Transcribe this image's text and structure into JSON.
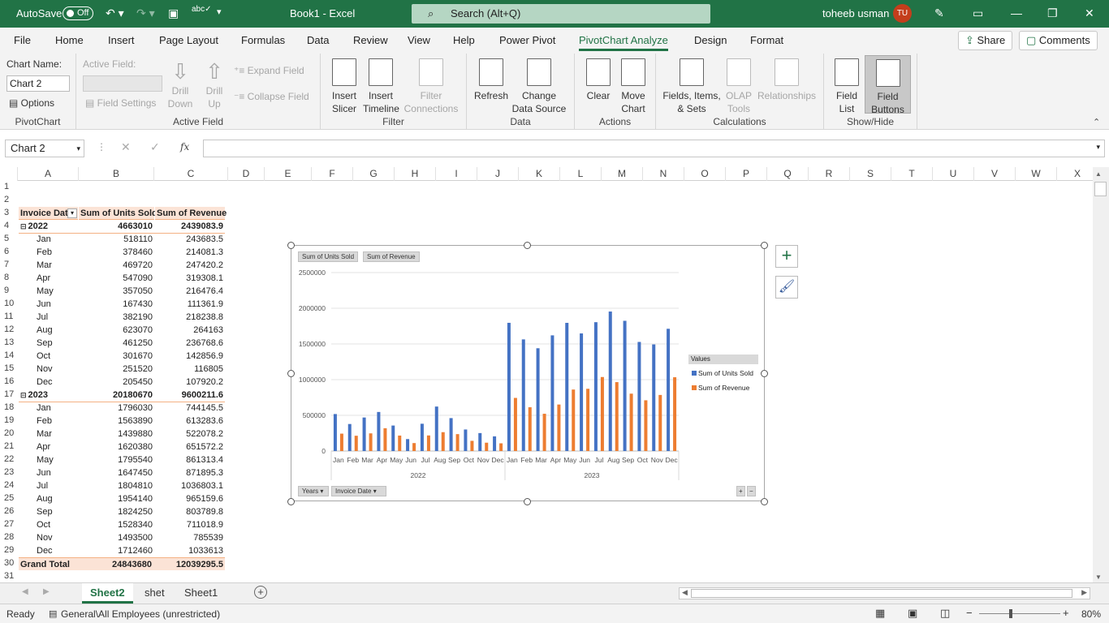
{
  "titlebar": {
    "autosave": "AutoSave",
    "toggle": "Off",
    "doc": "Book1  -  Excel",
    "search": "Search (Alt+Q)",
    "user": "toheeb usman",
    "initials": "TU"
  },
  "tabs": [
    "File",
    "Home",
    "Insert",
    "Page Layout",
    "Formulas",
    "Data",
    "Review",
    "View",
    "Help",
    "Power Pivot",
    "PivotChart Analyze",
    "Design",
    "Format"
  ],
  "share": "Share",
  "comments": "Comments",
  "ribbon": {
    "pivotchart": {
      "label": "PivotChart",
      "name_label": "Chart Name:",
      "name_value": "Chart 2",
      "options": "Options"
    },
    "activefield": {
      "label": "Active Field",
      "field_label": "Active Field:",
      "field_settings": "Field Settings",
      "drill_down": "Drill Down",
      "drill_up": "Drill Up",
      "expand": "Expand Field",
      "collapse": "Collapse Field"
    },
    "filter": {
      "label": "Filter",
      "insert_slicer": "Insert Slicer",
      "insert_timeline": "Insert Timeline",
      "filter_connections": "Filter Connections"
    },
    "data": {
      "label": "Data",
      "refresh": "Refresh",
      "change_source": "Change Data Source"
    },
    "actions": {
      "label": "Actions",
      "clear": "Clear",
      "move_chart": "Move Chart"
    },
    "calculations": {
      "label": "Calculations",
      "fields_items": "Fields, Items, & Sets",
      "olap": "OLAP Tools",
      "relationships": "Relationships"
    },
    "showhide": {
      "label": "Show/Hide",
      "field_list": "Field List",
      "field_buttons": "Field Buttons"
    }
  },
  "namebox": "Chart 2",
  "columns": [
    "A",
    "B",
    "C",
    "D",
    "E",
    "F",
    "G",
    "H",
    "I",
    "J",
    "K",
    "L",
    "M",
    "N",
    "O",
    "P",
    "Q",
    "R",
    "S",
    "T",
    "U",
    "V",
    "W",
    "X"
  ],
  "pivot": {
    "headers": [
      "Invoice Dat",
      "Sum of Units Sold",
      "Sum of Revenue"
    ],
    "rows": [
      {
        "label": "2022",
        "units": "4663010",
        "revenue": "2439083.9",
        "year": true
      },
      {
        "label": "Jan",
        "units": "518110",
        "revenue": "243683.5"
      },
      {
        "label": "Feb",
        "units": "378460",
        "revenue": "214081.3"
      },
      {
        "label": "Mar",
        "units": "469720",
        "revenue": "247420.2"
      },
      {
        "label": "Apr",
        "units": "547090",
        "revenue": "319308.1"
      },
      {
        "label": "May",
        "units": "357050",
        "revenue": "216476.4"
      },
      {
        "label": "Jun",
        "units": "167430",
        "revenue": "111361.9"
      },
      {
        "label": "Jul",
        "units": "382190",
        "revenue": "218238.8"
      },
      {
        "label": "Aug",
        "units": "623070",
        "revenue": "264163"
      },
      {
        "label": "Sep",
        "units": "461250",
        "revenue": "236768.6"
      },
      {
        "label": "Oct",
        "units": "301670",
        "revenue": "142856.9"
      },
      {
        "label": "Nov",
        "units": "251520",
        "revenue": "116805"
      },
      {
        "label": "Dec",
        "units": "205450",
        "revenue": "107920.2"
      },
      {
        "label": "2023",
        "units": "20180670",
        "revenue": "9600211.6",
        "year": true
      },
      {
        "label": "Jan",
        "units": "1796030",
        "revenue": "744145.5"
      },
      {
        "label": "Feb",
        "units": "1563890",
        "revenue": "613283.6"
      },
      {
        "label": "Mar",
        "units": "1439880",
        "revenue": "522078.2"
      },
      {
        "label": "Apr",
        "units": "1620380",
        "revenue": "651572.2"
      },
      {
        "label": "May",
        "units": "1795540",
        "revenue": "861313.4"
      },
      {
        "label": "Jun",
        "units": "1647450",
        "revenue": "871895.3"
      },
      {
        "label": "Jul",
        "units": "1804810",
        "revenue": "1036803.1"
      },
      {
        "label": "Aug",
        "units": "1954140",
        "revenue": "965159.6"
      },
      {
        "label": "Sep",
        "units": "1824250",
        "revenue": "803789.8"
      },
      {
        "label": "Oct",
        "units": "1528340",
        "revenue": "711018.9"
      },
      {
        "label": "Nov",
        "units": "1493500",
        "revenue": "785539"
      },
      {
        "label": "Dec",
        "units": "1712460",
        "revenue": "1033613"
      }
    ],
    "grand_total": {
      "label": "Grand Total",
      "units": "24843680",
      "revenue": "12039295.5"
    }
  },
  "chart_data": {
    "type": "bar",
    "categories": [
      "Jan",
      "Feb",
      "Mar",
      "Apr",
      "May",
      "Jun",
      "Jul",
      "Aug",
      "Sep",
      "Oct",
      "Nov",
      "Dec",
      "Jan",
      "Feb",
      "Mar",
      "Apr",
      "May",
      "Jun",
      "Jul",
      "Aug",
      "Sep",
      "Oct",
      "Nov",
      "Dec"
    ],
    "groups": [
      {
        "label": "2022",
        "count": 12
      },
      {
        "label": "2023",
        "count": 12
      }
    ],
    "series": [
      {
        "name": "Sum of Units Sold",
        "color": "#4472c4",
        "values": [
          518110,
          378460,
          469720,
          547090,
          357050,
          167430,
          382190,
          623070,
          461250,
          301670,
          251520,
          205450,
          1796030,
          1563890,
          1439880,
          1620380,
          1795540,
          1647450,
          1804810,
          1954140,
          1824250,
          1528340,
          1493500,
          1712460
        ]
      },
      {
        "name": "Sum of Revenue",
        "color": "#ed7d31",
        "values": [
          243683.5,
          214081.3,
          247420.2,
          319308.1,
          216476.4,
          111361.9,
          218238.8,
          264163,
          236768.6,
          142856.9,
          116805,
          107920.2,
          744145.5,
          613283.6,
          522078.2,
          651572.2,
          861313.4,
          871895.3,
          1036803.1,
          965159.6,
          803789.8,
          711018.9,
          785539,
          1033613
        ]
      }
    ],
    "ylim": [
      0,
      2500000
    ],
    "yticks": [
      "2500000",
      "2000000",
      "1500000",
      "1000000",
      "500000",
      "0"
    ],
    "legend_title": "Values",
    "legend_position": "right",
    "value_buttons": [
      "Sum of Units Sold",
      "Sum of Revenue"
    ],
    "axis_buttons": [
      "Years",
      "Invoice Date"
    ]
  },
  "sheets": [
    "Sheet2",
    "shet",
    "Sheet1"
  ],
  "status": {
    "ready": "Ready",
    "sensitivity": "General\\All Employees (unrestricted)",
    "zoom": "80%"
  }
}
